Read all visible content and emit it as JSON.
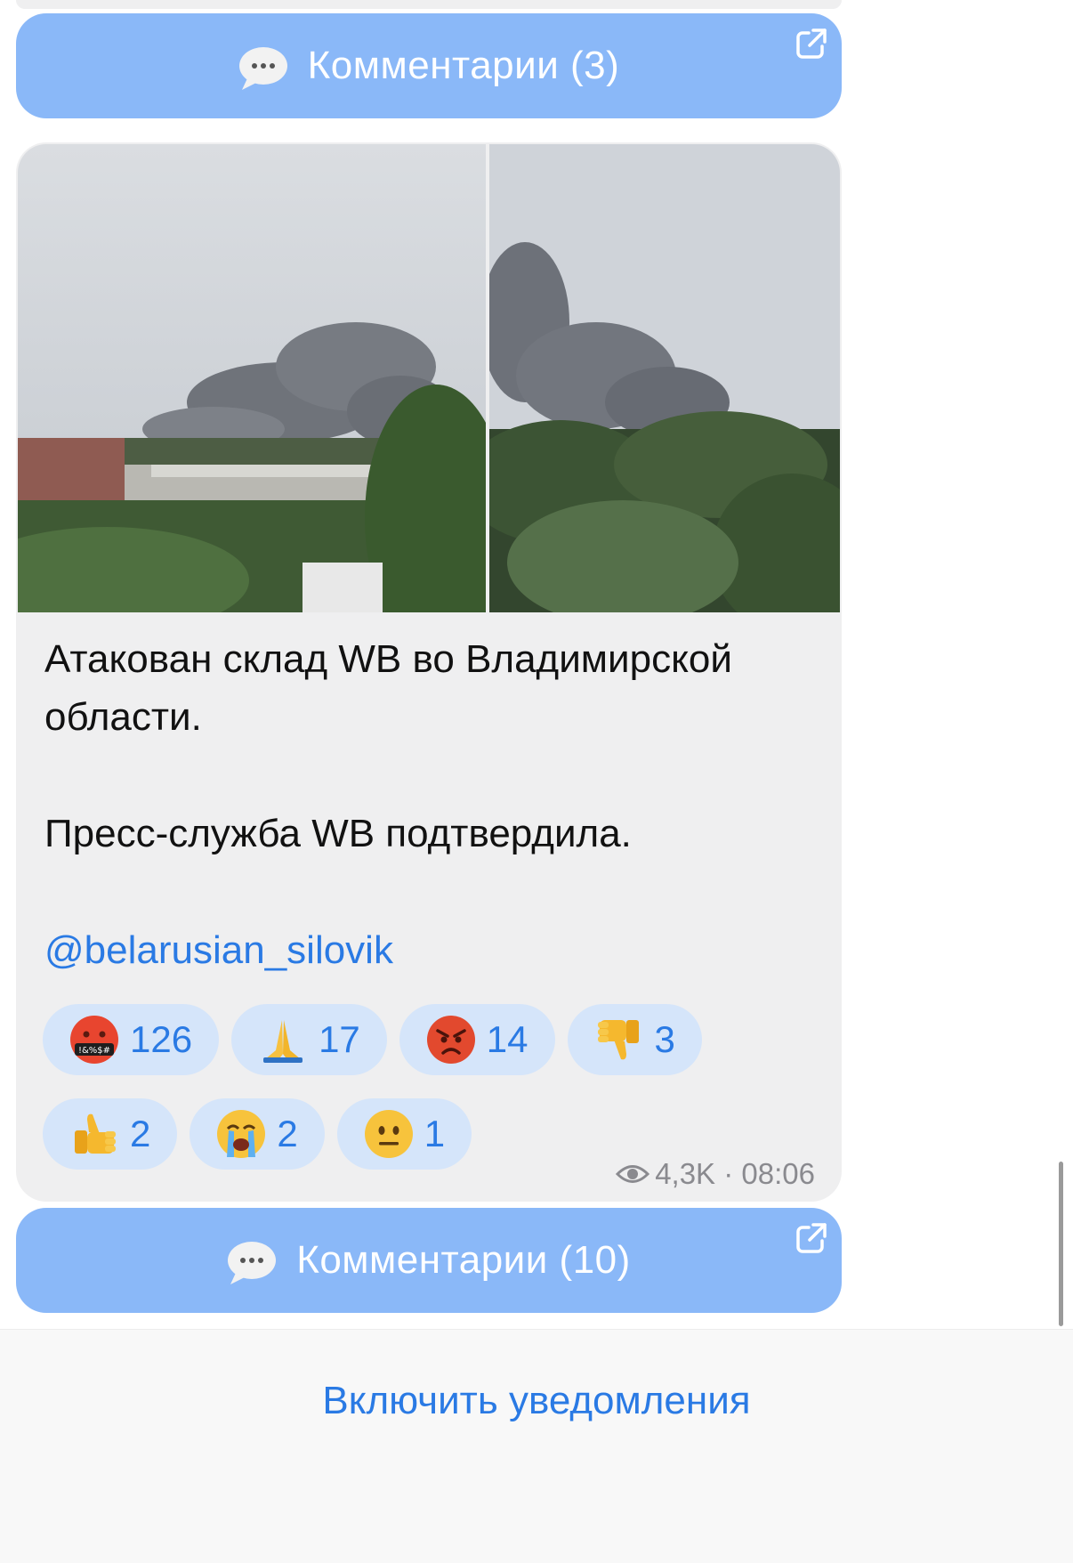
{
  "comments_top": {
    "label": "Комментарии (3)"
  },
  "post": {
    "paragraphs": [
      "Атакован склад WB во Владимирской области.",
      "Пресс-служба WB подтвердила."
    ],
    "mention": "@belarusian_silovik",
    "reactions": [
      {
        "emoji": "cursing-face",
        "count": "126"
      },
      {
        "emoji": "folded-hands",
        "count": "17"
      },
      {
        "emoji": "angry-face",
        "count": "14"
      },
      {
        "emoji": "thumbs-down",
        "count": "3"
      },
      {
        "emoji": "thumbs-up",
        "count": "2"
      },
      {
        "emoji": "crying-face",
        "count": "2"
      },
      {
        "emoji": "neutral-face",
        "count": "1"
      }
    ],
    "views": "4,3K",
    "time": "08:06"
  },
  "comments_bottom": {
    "label": "Комментарии (10)"
  },
  "footer": {
    "notify_label": "Включить уведомления"
  },
  "colors": {
    "accent": "#2a7ae4",
    "comments_button": "#8ab8f8",
    "reaction_bg": "#d5e5fa"
  }
}
